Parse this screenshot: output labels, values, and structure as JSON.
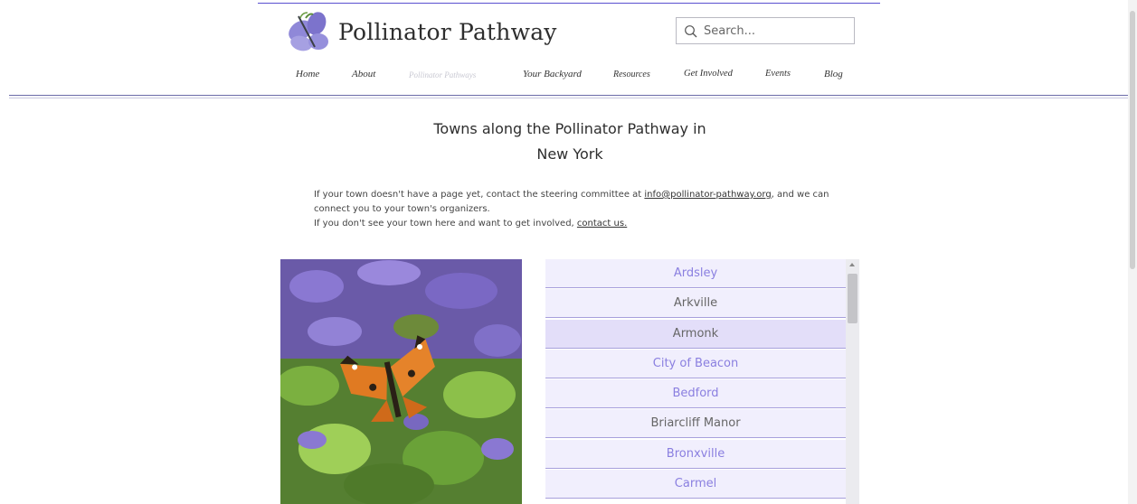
{
  "site": {
    "title": "Pollinator Pathway"
  },
  "search": {
    "placeholder": "Search..."
  },
  "nav": [
    {
      "label": "Home",
      "active": false
    },
    {
      "label": "About",
      "active": false
    },
    {
      "label": "Pollinator Pathways",
      "active": true
    },
    {
      "label": "Your Backyard",
      "active": false
    },
    {
      "label": "Resources",
      "active": false
    },
    {
      "label": "Get Involved",
      "active": false
    },
    {
      "label": "Events",
      "active": false
    },
    {
      "label": "Blog",
      "active": false
    }
  ],
  "page": {
    "title_line1": "Towns along the Pollinator Pathway in",
    "title_line2": "New York"
  },
  "intro": {
    "p1_pre": "If your town doesn't have a page yet, contact the steering committee at ",
    "email": "info@pollinator-pathway.org",
    "p1_post": ", and we can connect you to your town's organizers.",
    "p2_pre": "If you don't see your town here and want to get involved, ",
    "contact_link": "contact us."
  },
  "towns": [
    {
      "name": "Ardsley"
    },
    {
      "name": "Arkville"
    },
    {
      "name": "Armonk"
    },
    {
      "name": "City of Beacon"
    },
    {
      "name": "Bedford"
    },
    {
      "name": "Briarcliff Manor"
    },
    {
      "name": "Bronxville"
    },
    {
      "name": "Carmel"
    }
  ],
  "colors": {
    "accent": "#8a7fe0",
    "list_background": "#f1effd",
    "list_selected": "#e3def9",
    "rule": "#6a6aa8"
  }
}
